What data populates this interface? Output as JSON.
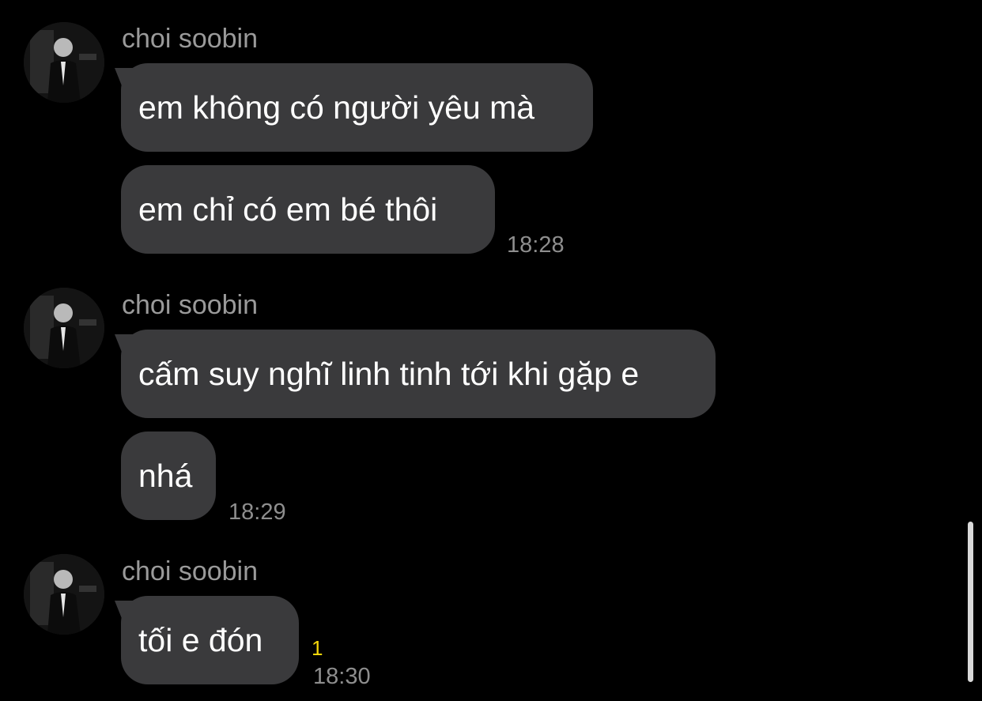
{
  "messages": [
    {
      "sender": "choi soobin",
      "avatar_icon": "profile-photo-avatar",
      "bubbles": [
        "em không có người yêu mà",
        "em chỉ có em bé thôi"
      ],
      "time": "18:28"
    },
    {
      "sender": "choi soobin",
      "avatar_icon": "profile-photo-avatar",
      "bubbles": [
        "cấm suy nghĩ linh tinh tới khi gặp e",
        "nhá"
      ],
      "time": "18:29"
    },
    {
      "sender": "choi soobin",
      "avatar_icon": "profile-photo-avatar",
      "bubbles": [
        "tối e đón"
      ],
      "unread": "1",
      "time": "18:30"
    }
  ],
  "colors": {
    "background": "#000000",
    "bubble": "#3a3a3c",
    "unread": "#f5d60a"
  }
}
